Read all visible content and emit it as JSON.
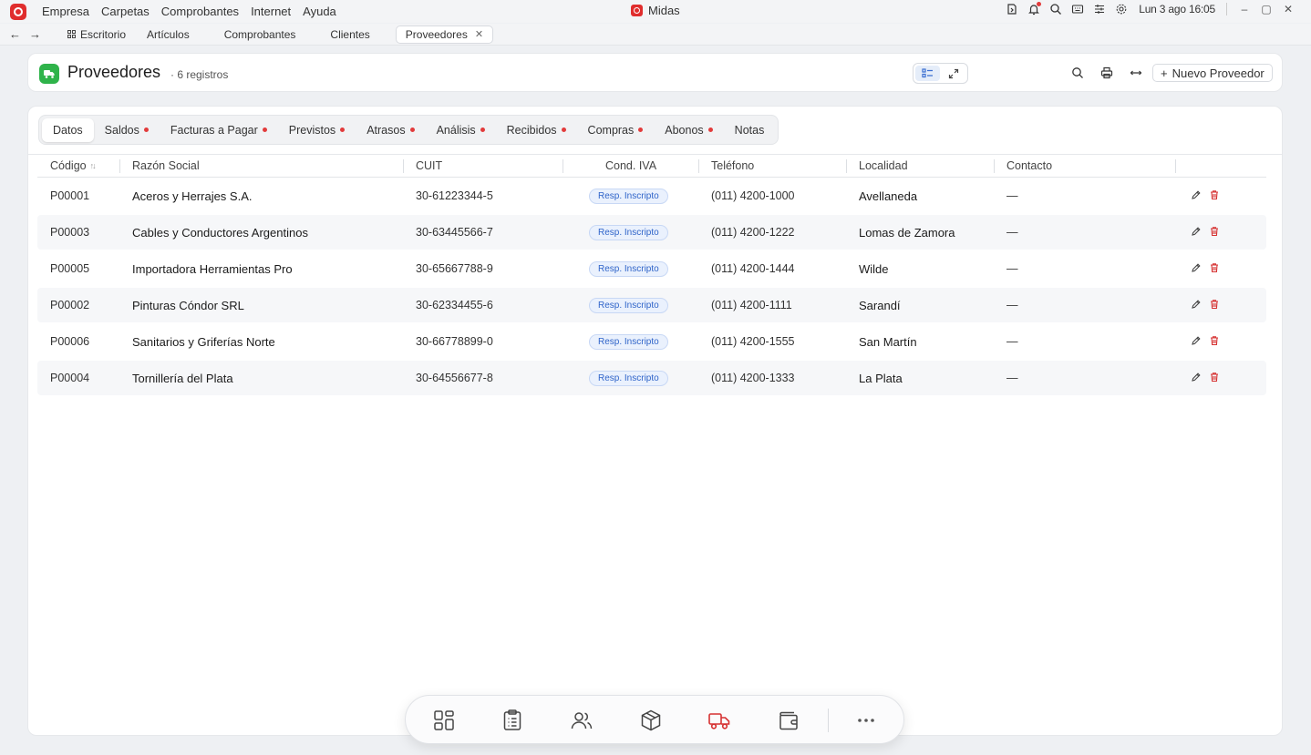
{
  "app": {
    "menu": [
      "Empresa",
      "Carpetas",
      "Comprobantes",
      "Internet",
      "Ayuda"
    ],
    "window_title": "Midas",
    "clock_day": "Lun 3 ago",
    "clock_time": "16:05",
    "brand_color": "#e02d2d"
  },
  "window_tabs": [
    {
      "label": "Escritorio"
    },
    {
      "label": "Artículos"
    },
    {
      "label": "Comprobantes"
    },
    {
      "label": "Clientes"
    },
    {
      "label": "Proveedores",
      "active": true
    }
  ],
  "header": {
    "title": "Proveedores",
    "count": "· 6 registros",
    "new_button": "Nuevo Proveedor",
    "icon_color": "#2fb34a"
  },
  "sections": [
    {
      "label": "Datos",
      "active": true,
      "dot": false
    },
    {
      "label": "Saldos",
      "dot": true
    },
    {
      "label": "Facturas a Pagar",
      "dot": true
    },
    {
      "label": "Previstos",
      "dot": true
    },
    {
      "label": "Atrasos",
      "dot": true
    },
    {
      "label": "Análisis",
      "dot": true
    },
    {
      "label": "Recibidos",
      "dot": true
    },
    {
      "label": "Compras",
      "dot": true
    },
    {
      "label": "Abonos",
      "dot": true
    },
    {
      "label": "Notas",
      "dot": false
    }
  ],
  "table": {
    "columns": [
      "Código",
      "Razón Social",
      "CUIT",
      "Cond. IVA",
      "Teléfono",
      "Localidad",
      "Contacto"
    ],
    "rows": [
      {
        "codigo": "P00001",
        "razon": "Aceros y Herrajes S.A.",
        "cuit": "30-61223344-5",
        "iva": "Resp. Inscripto",
        "tel": "(011) 4200-1000",
        "localidad": "Avellaneda",
        "contacto": "—"
      },
      {
        "codigo": "P00003",
        "razon": "Cables y Conductores Argentinos",
        "cuit": "30-63445566-7",
        "iva": "Resp. Inscripto",
        "tel": "(011) 4200-1222",
        "localidad": "Lomas de Zamora",
        "contacto": "—"
      },
      {
        "codigo": "P00005",
        "razon": "Importadora Herramientas Pro",
        "cuit": "30-65667788-9",
        "iva": "Resp. Inscripto",
        "tel": "(011) 4200-1444",
        "localidad": "Wilde",
        "contacto": "—"
      },
      {
        "codigo": "P00002",
        "razon": "Pinturas Cóndor SRL",
        "cuit": "30-62334455-6",
        "iva": "Resp. Inscripto",
        "tel": "(011) 4200-1111",
        "localidad": "Sarandí",
        "contacto": "—"
      },
      {
        "codigo": "P00006",
        "razon": "Sanitarios y Griferías Norte",
        "cuit": "30-66778899-0",
        "iva": "Resp. Inscripto",
        "tel": "(011) 4200-1555",
        "localidad": "San Martín",
        "contacto": "—"
      },
      {
        "codigo": "P00004",
        "razon": "Tornillería del Plata",
        "cuit": "30-64556677-8",
        "iva": "Resp. Inscripto",
        "tel": "(011) 4200-1333",
        "localidad": "La Plata",
        "contacto": "—"
      }
    ]
  },
  "dock": {
    "items": [
      "dashboard-icon",
      "clipboard-icon",
      "users-icon",
      "box-icon",
      "truck-icon",
      "wallet-icon",
      "more-icon"
    ],
    "active_color": "#d63131"
  }
}
